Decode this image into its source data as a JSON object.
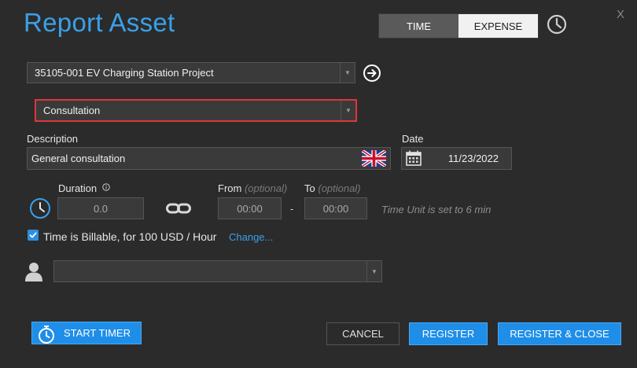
{
  "dialog": {
    "title": "Report Asset",
    "close_label": "X"
  },
  "mode_tabs": [
    {
      "label": "TIME",
      "active": true
    },
    {
      "label": "EXPENSE",
      "active": false
    }
  ],
  "icons": {
    "history": "clock-history-icon",
    "go": "arrow-right-circle-icon",
    "flag": "uk-flag-icon",
    "calendar": "calendar-icon",
    "info": "info-circle-icon",
    "duration": "clock-icon",
    "link": "chain-link-icon",
    "person": "person-icon",
    "timer": "stopwatch-icon"
  },
  "project": {
    "selected": "35105-001 EV Charging Station Project"
  },
  "category": {
    "selected": "Consultation",
    "highlight_color": "#e0353b"
  },
  "description": {
    "label": "Description",
    "value": "General consultation"
  },
  "date": {
    "label": "Date",
    "value": "11/23/2022"
  },
  "duration": {
    "label": "Duration",
    "value": "0.0"
  },
  "from": {
    "label": "From",
    "hint": "(optional)",
    "value": "00:00"
  },
  "to": {
    "label": "To",
    "hint": "(optional)",
    "value": "00:00"
  },
  "range_separator": "-",
  "time_unit_note": "Time Unit is set to 6 min",
  "billable": {
    "checked": true,
    "text": "Time is Billable, for 100 USD / Hour",
    "change_link": "Change..."
  },
  "assignee": {
    "selected": ""
  },
  "buttons": {
    "start_timer": "START TIMER",
    "cancel": "CANCEL",
    "register": "REGISTER",
    "register_close": "REGISTER & CLOSE"
  },
  "colors": {
    "accent": "#3aa0e8",
    "primary_button": "#1e8ee8",
    "background": "#2b2b2b"
  }
}
